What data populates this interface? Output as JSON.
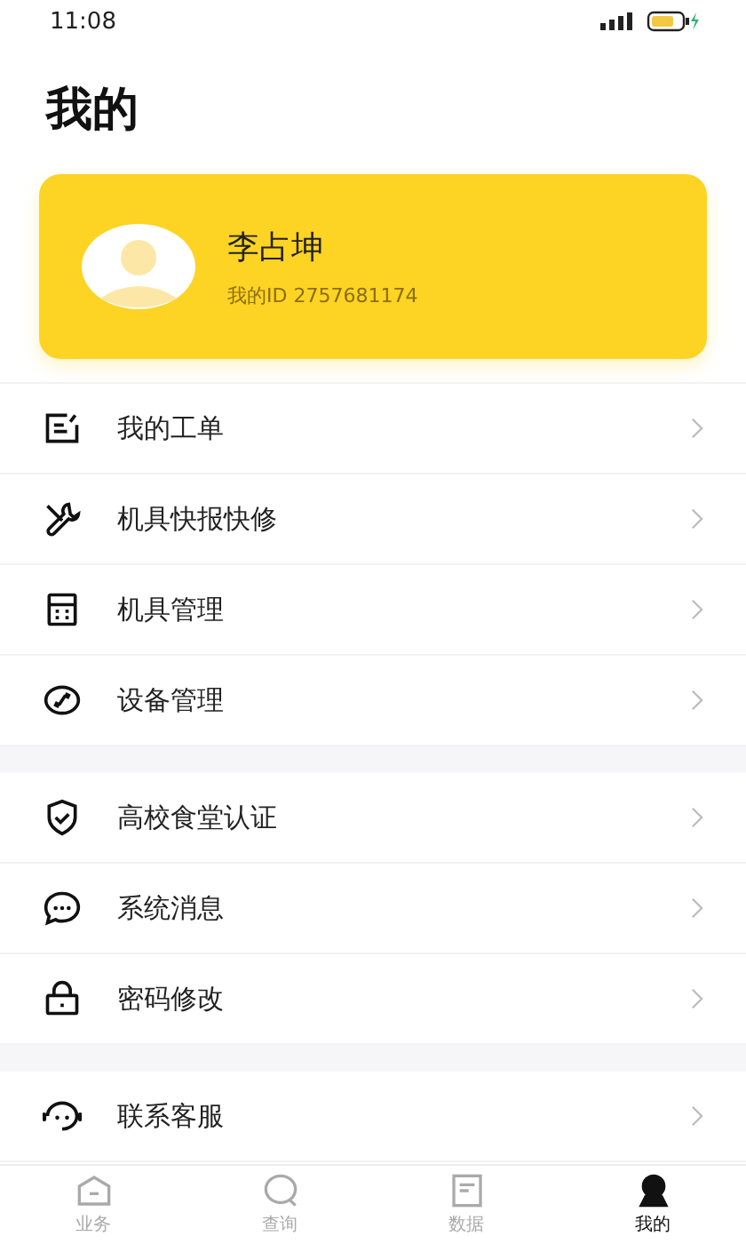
{
  "status_bar": {
    "time": "11:08"
  },
  "title": "我的",
  "profile": {
    "name": "李占坤",
    "id_text": "我的ID 2757681174"
  },
  "menu_groups": [
    [
      {
        "kind": "ticket",
        "label": "我的工单"
      },
      {
        "kind": "tools",
        "label": "机具快报快修"
      },
      {
        "kind": "calculator",
        "label": "机具管理"
      },
      {
        "kind": "link",
        "label": "设备管理"
      }
    ],
    [
      {
        "kind": "shield",
        "label": "高校食堂认证"
      },
      {
        "kind": "chat",
        "label": "系统消息"
      },
      {
        "kind": "lock",
        "label": "密码修改"
      }
    ],
    [
      {
        "kind": "headset",
        "label": "联系客服"
      }
    ]
  ],
  "tabs": [
    {
      "kind": "home",
      "label": "业务",
      "selected": false
    },
    {
      "kind": "search",
      "label": "查询",
      "selected": false
    },
    {
      "kind": "doc",
      "label": "数据",
      "selected": false
    },
    {
      "kind": "person",
      "label": "我的",
      "selected": true
    }
  ]
}
